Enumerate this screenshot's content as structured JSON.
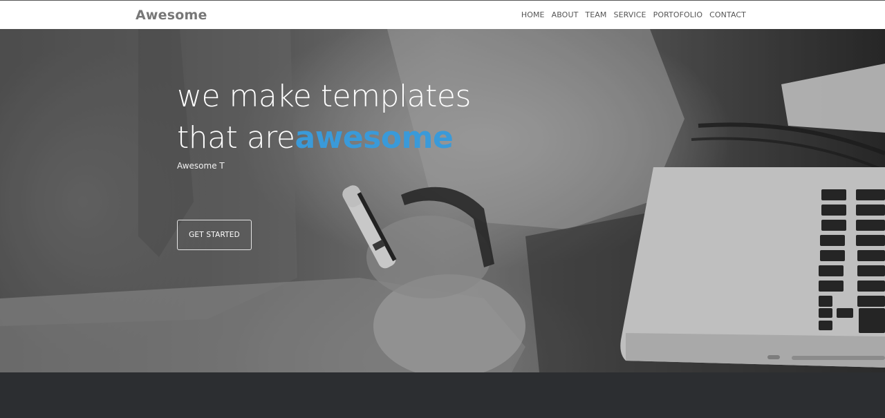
{
  "brand": {
    "name": "Awesome"
  },
  "nav": {
    "items": [
      {
        "label": "HOME"
      },
      {
        "label": "ABOUT"
      },
      {
        "label": "TEAM"
      },
      {
        "label": "SERVICE"
      },
      {
        "label": "PORTOFOLIO"
      },
      {
        "label": "CONTACT"
      }
    ]
  },
  "hero": {
    "line1": "we make templates",
    "line2_prefix": "that are",
    "line2_accent": "awesome",
    "subtitle": "Awesome T",
    "cta_label": "GET STARTED"
  },
  "colors": {
    "accent": "#3a9ad9",
    "footer": "#2c2e31",
    "topbar": "#ffffff"
  },
  "icons": {
    "hero_image": "photo-person-writing-with-laptop"
  }
}
